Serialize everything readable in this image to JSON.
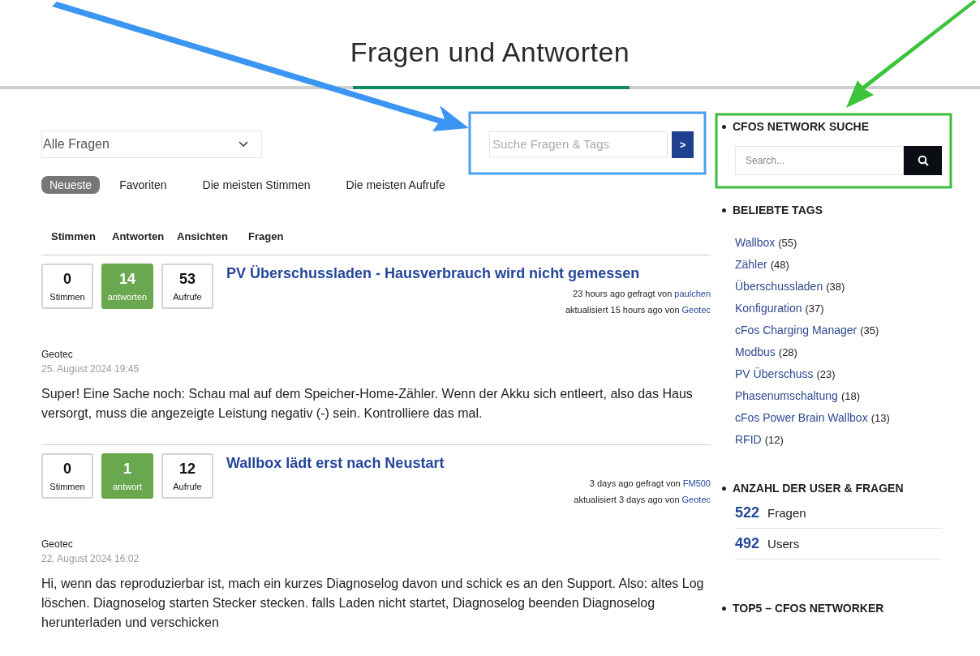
{
  "page_title": "Fragen und Antworten",
  "filter": {
    "value": "Alle Fragen"
  },
  "search": {
    "placeholder": "Suche Fragen & Tags",
    "button": ">"
  },
  "sort_tabs": [
    {
      "label": "Neueste",
      "selected": true
    },
    {
      "label": "Favoriten",
      "selected": false
    },
    {
      "label": "Die meisten Stimmen",
      "selected": false
    },
    {
      "label": "Die meisten Aufrufe",
      "selected": false
    }
  ],
  "columns": [
    "Stimmen",
    "Antworten",
    "Ansichten",
    "Fragen"
  ],
  "questions": [
    {
      "stats": [
        {
          "kind": "votes",
          "value": "0",
          "label": "Stimmen"
        },
        {
          "kind": "answers",
          "value": "14",
          "label": "antworten"
        },
        {
          "kind": "views",
          "value": "53",
          "label": "Aufrufe"
        }
      ],
      "title": "PV Überschussladen - Hausverbrauch wird nicht gemessen",
      "asked": {
        "text": "23 hours ago gefragt von",
        "user": "paulchen"
      },
      "updated": {
        "text": "aktualisiert 15 hours ago von",
        "user": "Geotec"
      },
      "last_answer": {
        "author": "Geotec",
        "date": "25. August 2024 19:45",
        "text": "Super! Eine Sache noch: Schau mal auf dem Speicher-Home-Zähler. Wenn der Akku sich entleert, also das Haus versorgt, muss die angezeigte Leistung negativ (-) sein. Kontrolliere das mal."
      }
    },
    {
      "stats": [
        {
          "kind": "votes",
          "value": "0",
          "label": "Stimmen"
        },
        {
          "kind": "answers",
          "value": "1",
          "label": "antwort"
        },
        {
          "kind": "views",
          "value": "12",
          "label": "Aufrufe"
        }
      ],
      "title": "Wallbox lädt erst nach Neustart",
      "asked": {
        "text": "3 days ago gefragt von",
        "user": "FM500"
      },
      "updated": {
        "text": "aktualisiert 3 days ago von",
        "user": "Geotec"
      },
      "last_answer": {
        "author": "Geotec",
        "date": "22. August 2024 16:02",
        "text": "Hi, wenn das reproduzierbar ist, mach ein kurzes Diagnoselog davon und schick es an den Support. Also: altes Log löschen. Diagnoselog starten Stecker stecken. falls Laden nicht startet, Diagnoselog beenden Diagnoselog herunterladen und verschicken"
      }
    }
  ],
  "sidebar": {
    "network_search": {
      "heading": "CFOS NETWORK SUCHE",
      "placeholder": "Search..."
    },
    "tags": {
      "heading": "BELIEBTE TAGS",
      "items": [
        {
          "name": "Wallbox",
          "count": "(55)"
        },
        {
          "name": "Zähler",
          "count": "(48)"
        },
        {
          "name": "Überschussladen",
          "count": "(38)"
        },
        {
          "name": "Konfiguration",
          "count": "(37)"
        },
        {
          "name": "cFos Charging Manager",
          "count": "(35)"
        },
        {
          "name": "Modbus",
          "count": "(28)"
        },
        {
          "name": "PV Überschuss",
          "count": "(23)"
        },
        {
          "name": "Phasenumschaltung",
          "count": "(18)"
        },
        {
          "name": "cFos Power Brain Wallbox",
          "count": "(13)"
        },
        {
          "name": "RFID",
          "count": "(12)"
        }
      ]
    },
    "counts": {
      "heading": "ANZAHL DER USER & FRAGEN",
      "items": [
        {
          "number": "522",
          "label": "Fragen"
        },
        {
          "number": "492",
          "label": "Users"
        }
      ]
    },
    "top5": {
      "heading": "TOP5 – CFOS NETWORKER"
    }
  }
}
